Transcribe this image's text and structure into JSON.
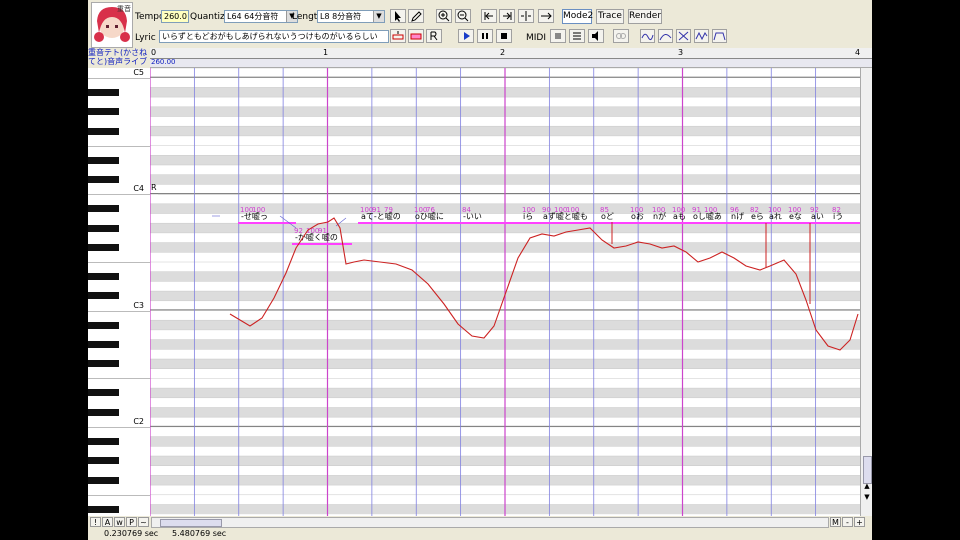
{
  "toolbar": {
    "avatar_caption": "重音",
    "tempo_label": "Tempo",
    "tempo_value": "260.0",
    "quantize_label": "Quantize",
    "quantize_value": "L64 64分音符",
    "length_label": "Length",
    "length_value": "L8 8分音符",
    "lyric_label": "Lyric",
    "lyric_value": "いらずともどおがもしあげられないうつけものがいるらしい",
    "midi_label": "MIDI",
    "mode_button": "Mode2",
    "trace_button": "Trace",
    "render_button": "Render"
  },
  "track": {
    "name_line1": "重音テト(かさね",
    "name_line2": "てと)音声ライブ",
    "tempo_mark": "260.00"
  },
  "ruler": {
    "origin": "0",
    "measures": [
      "1",
      "2",
      "3",
      "4"
    ]
  },
  "keyboard": {
    "octaves": [
      "C5",
      "C4",
      "C3",
      "C2"
    ],
    "rest_marker": "R"
  },
  "notes": [
    {
      "lyric": "-せ嘘っ",
      "values": [
        "100",
        "100"
      ]
    },
    {
      "lyric": "-か嘘く嘘の",
      "values": [
        "92",
        "100",
        "91"
      ]
    },
    {
      "lyric": "aて-と嘘の",
      "values": [
        "100",
        "91",
        "79"
      ]
    },
    {
      "lyric": "oひ嘘に",
      "values": [
        "100",
        "76"
      ]
    },
    {
      "lyric": "-いい",
      "values": [
        "84"
      ]
    },
    {
      "lyric": "iら",
      "values": [
        "100"
      ]
    },
    {
      "lyric": "aず嘘と嘘も",
      "values": [
        "90",
        "100",
        "100"
      ]
    },
    {
      "lyric": "oど",
      "values": [
        "85"
      ]
    },
    {
      "lyric": "oお",
      "values": [
        "100"
      ]
    },
    {
      "lyric": "nが",
      "values": [
        "100"
      ]
    },
    {
      "lyric": "aも",
      "values": [
        "100"
      ]
    },
    {
      "lyric": "oし嘘あ",
      "values": [
        "91",
        "100"
      ]
    },
    {
      "lyric": "nげ",
      "values": [
        "96"
      ]
    },
    {
      "lyric": "eら",
      "values": [
        "82"
      ]
    },
    {
      "lyric": "aれ",
      "values": [
        "100"
      ]
    },
    {
      "lyric": "eな",
      "values": [
        "100"
      ]
    },
    {
      "lyric": "aい",
      "values": [
        "92"
      ]
    },
    {
      "lyric": "iう",
      "values": [
        "82"
      ]
    }
  ],
  "bottom": {
    "btn_excl": "!",
    "btn_a": "A",
    "btn_w": "w",
    "btn_p": "P",
    "btn_tilde": "~",
    "btn_m": "M",
    "btn_minus": "-",
    "btn_plus": "+",
    "time_left": "0.230769 sec",
    "time_right": "5.480769 sec"
  },
  "colors": {
    "note_magenta": "#ff40ff",
    "pitch_curve": "#cc2222",
    "measure_line": "#cc44cc",
    "beat_line": "#8080e0"
  }
}
